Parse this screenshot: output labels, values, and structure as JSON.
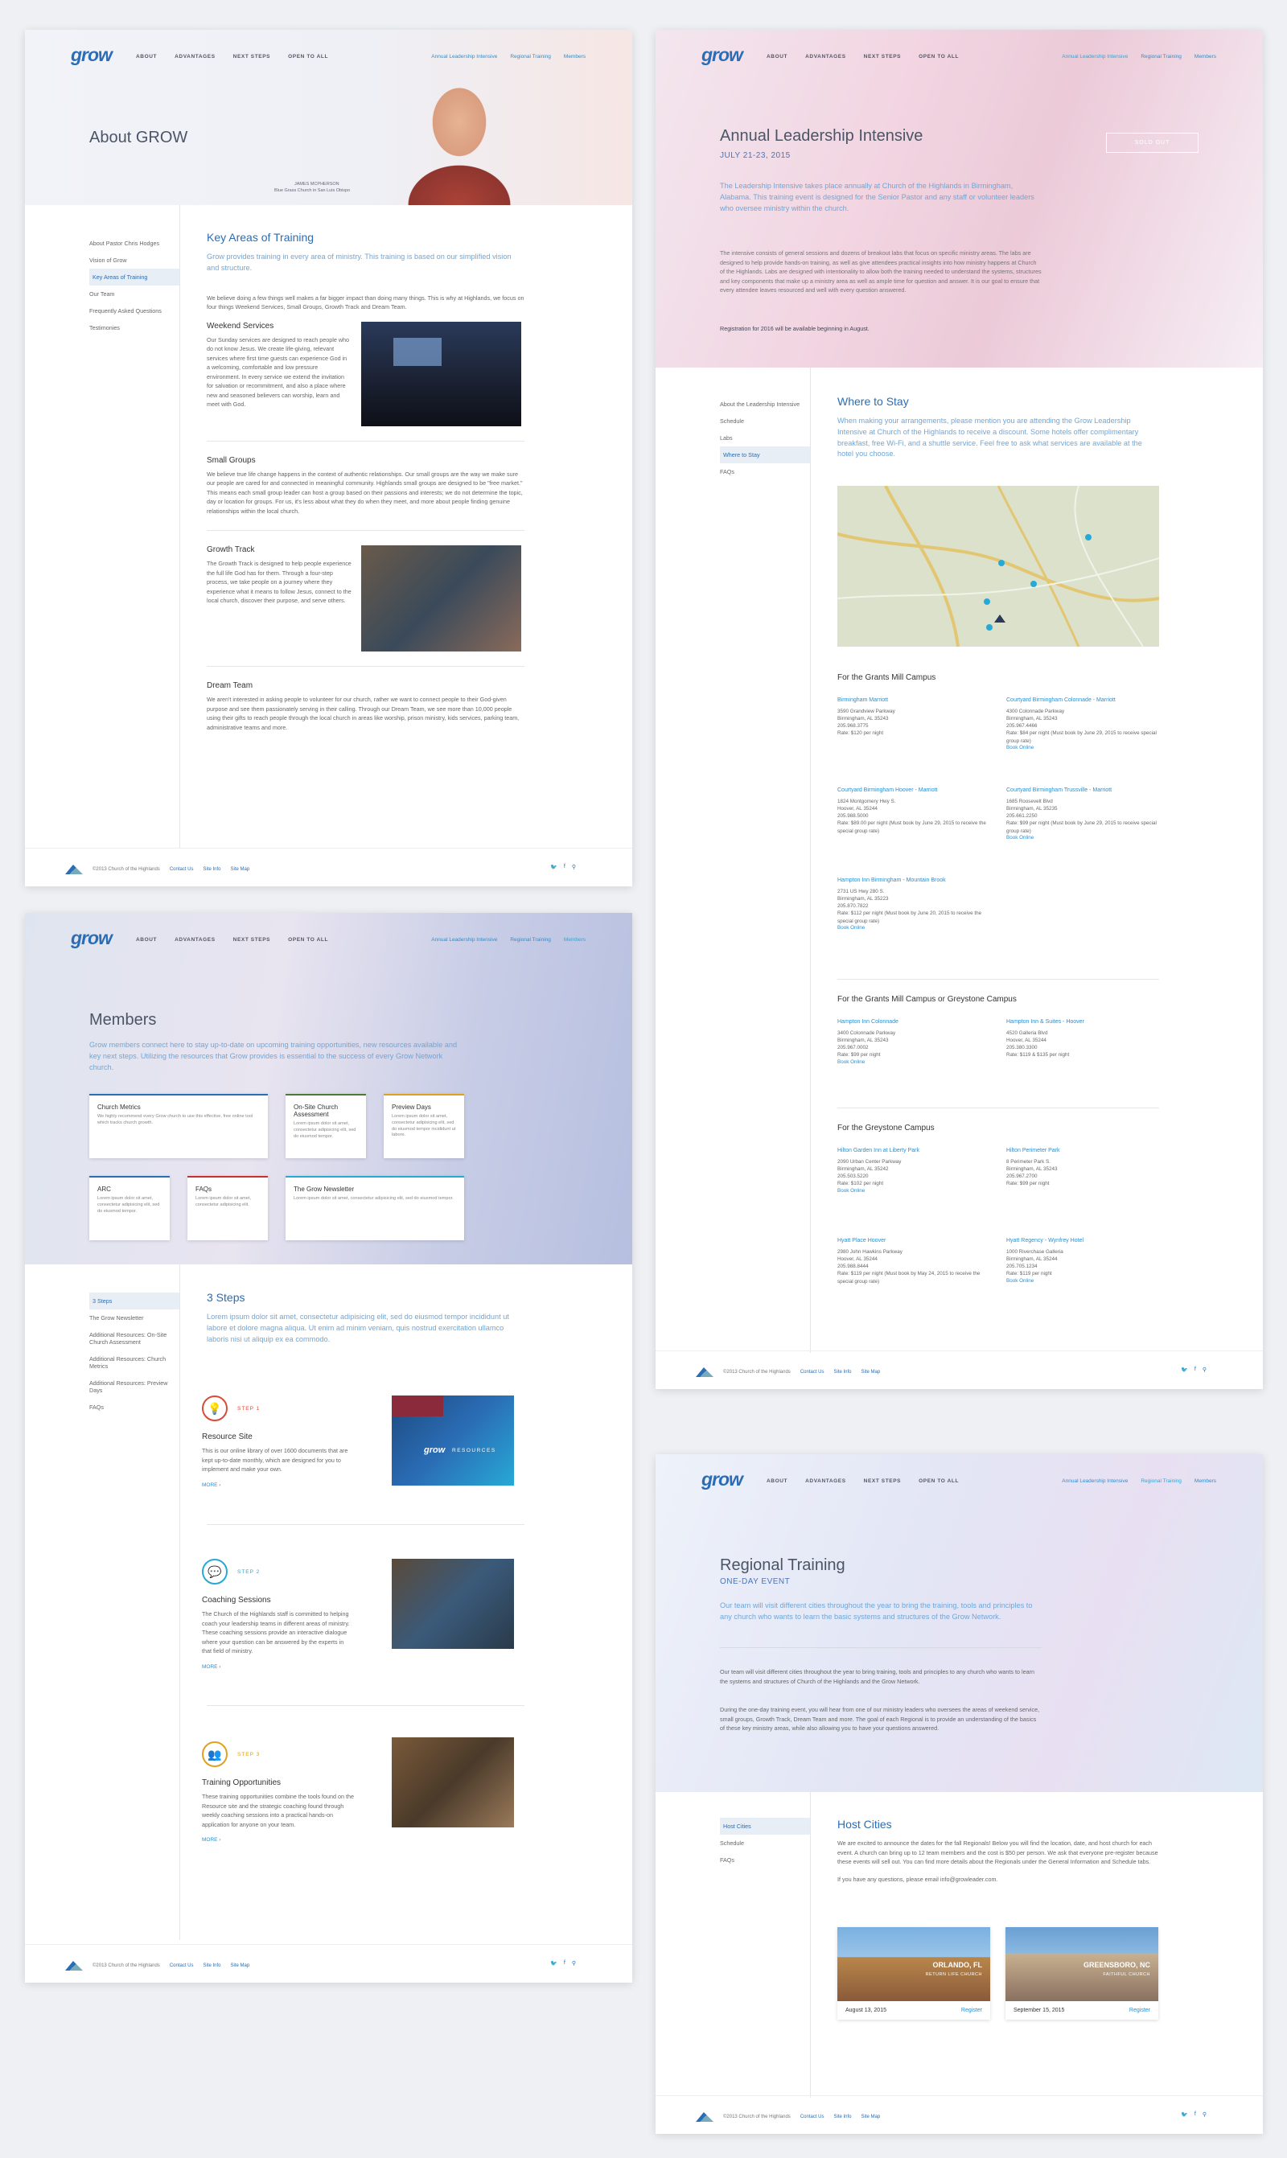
{
  "nav": {
    "logo": "grow",
    "left": [
      "ABOUT",
      "ADVANTAGES",
      "NEXT STEPS",
      "OPEN TO ALL"
    ],
    "right": [
      "Annual Leadership Intensive",
      "Regional Training",
      "Members"
    ]
  },
  "footer": {
    "copyright": "©2013 Church of the Highlands",
    "links": [
      "Contact Us",
      "Site Info",
      "Site Map"
    ],
    "icons": [
      "twitter-icon",
      "facebook-icon",
      "search-icon"
    ]
  },
  "about": {
    "title": "About GROW",
    "caption_name": "JAMES MCPHERSON",
    "caption_role": "Blue Grass Church in San Luis Obispo",
    "sidebar": [
      "About Pastor Chris Hodges",
      "Vision of Grow",
      "Key Areas of Training",
      "Our Team",
      "Frequently Asked Questions",
      "Testimonies"
    ],
    "sidebar_active": 2,
    "heading": "Key Areas of Training",
    "lead": "Grow provides training in every area of ministry. This training is based on our simplified vision and structure.",
    "intro": "We believe doing a few things well makes a far bigger impact than doing many things. This is why at Highlands, we focus on four things Weekend Services, Small Groups, Growth Track and Dream Team.",
    "sections": [
      {
        "title": "Weekend Services",
        "text": "Our Sunday services are designed to reach people who do not know Jesus. We create life-giving, relevant services where first time guests can experience God in a welcoming, comfortable and low pressure environment. In every service we extend the invitation for salvation or recommitment, and also a place where new and seasoned believers can worship, learn and meet with God."
      },
      {
        "title": "Small Groups",
        "text": "We believe true life change happens in the context of authentic relationships. Our small groups are the way we make sure our people are cared for and connected in meaningful community. Highlands small groups are designed to be \"free market.\" This means each small group leader can host a group based on their passions and interests; we do not determine the topic, day or location for groups. For us, it's less about what they do when they meet, and more about people finding genuine relationships within the local church."
      },
      {
        "title": "Growth Track",
        "text": "The Growth Track is designed to help people experience the full life God has for them. Through a four-step process, we take people on a journey where they experience what it means to follow Jesus, connect to the local church, discover their purpose, and serve others."
      },
      {
        "title": "Dream Team",
        "text": "We aren't interested in asking people to volunteer for our church, rather we want to connect people to their God-given purpose and see them passionately serving in their calling. Through our Dream Team, we see more than 10,000 people using their gifts to reach people through the local church in areas like worship, prison ministry, kids services, parking team, administrative teams and more."
      }
    ]
  },
  "members": {
    "title": "Members",
    "lead": "Grow members connect here to stay up-to-date on upcoming training opportunities, new resources available and key next steps. Utilizing the resources that Grow provides is essential to the success of every Grow Network church.",
    "cards": [
      {
        "title": "Church Metrics",
        "text": "We highly recommend every Grow church to use this effective, free online tool which tracks church growth.",
        "color": "#2a6db5"
      },
      {
        "title": "On-Site Church Assessment",
        "text": "Lorem ipsum dolor sit amet, consectetur adipisicing elit, sed do eiusmod tempor.",
        "color": "#4a7a3a"
      },
      {
        "title": "Preview Days",
        "text": "Lorem ipsum dolor sit amet, consectetur adipisicing elit, sed do eiusmod tempor incididunt ut labore.",
        "color": "#e0a020"
      },
      {
        "title": "ARC",
        "text": "Lorem ipsum dolor sit amet, consectetur adipisicing elit, sed do eiusmod tempor.",
        "color": "#2a6db5"
      },
      {
        "title": "FAQs",
        "text": "Lorem ipsum dolor sit amet, consectetur adipisicing elit.",
        "color": "#c83030"
      },
      {
        "title": "The Grow Newsletter",
        "text": "Lorem ipsum dolor sit amet, consectetur adipisicing elit, sed do eiusmod tempor.",
        "color": "#27a9d6"
      }
    ],
    "sidebar": [
      "3 Steps",
      "The Grow Newsletter",
      "Additional Resources: On-Site Church Assessment",
      "Additional Resources: Church Metrics",
      "Additional Resources: Preview Days",
      "FAQs"
    ],
    "sidebar_active": 0,
    "heading": "3 Steps",
    "steps_lead": "Lorem ipsum dolor sit amet, consectetur adipisicing elit, sed do eiusmod tempor incididunt ut labore et dolore magna aliqua. Ut enim ad minim veniam, quis nostrud exercitation ullamco laboris nisi ut aliquip ex ea commodo.",
    "steps": [
      {
        "label": "STEP 1",
        "title": "Resource Site",
        "text": "This is our online library of over 1600 documents that are kept up-to-date monthly, which are designed for you to implement and make your own.",
        "more": "MORE",
        "color": "#d84a3a",
        "icon": "lightbulb-icon"
      },
      {
        "label": "STEP 2",
        "title": "Coaching Sessions",
        "text": "The Church of the Highlands staff is committed to helping coach your leadership teams in different areas of ministry. These coaching sessions provide an interactive dialogue where your question can be answered by the experts in that field of ministry.",
        "more": "MORE",
        "color": "#27a9d6",
        "icon": "chat-icon"
      },
      {
        "label": "STEP 3",
        "title": "Training Opportunities",
        "text": "These training opportunities combine the tools found on the Resource site and the strategic coaching found through weekly coaching sessions into a practical hands-on application for anyone on your team.",
        "more": "MORE",
        "color": "#e0a020",
        "icon": "group-icon"
      }
    ],
    "resource_logo": "grow",
    "resource_word": "RESOURCES"
  },
  "intensive": {
    "title": "Annual Leadership Intensive",
    "date": "JULY 21-23, 2015",
    "badge": "SOLD OUT",
    "lead": "The Leadership Intensive takes place annually at Church of the Highlands in Birmingham, Alabama. This training event is designed for the Senior Pastor and any staff or volunteer leaders who oversee ministry within the church.",
    "body": "The intensive consists of general sessions and dozens of breakout labs that focus on specific ministry areas. The labs are designed to help provide hands-on training, as well as give attendees practical insights into how ministry happens at Church of the Highlands. Labs are designed with intentionality to allow both the training needed to understand the systems, structures and key components that make up a ministry area as well as ample time for question and answer. It is our goal to ensure that every attendee leaves resourced and well with every question answered.",
    "registration": "Registration for 2016 will be available beginning in August.",
    "sidebar": [
      "About the Leadership Intensive",
      "Schedule",
      "Labs",
      "Where to Stay",
      "FAQs"
    ],
    "sidebar_active": 3,
    "heading": "Where to Stay",
    "stay_lead": "When making your arrangements, please mention you are attending the Grow Leadership Intensive at Church of the Highlands to receive a discount. Some hotels offer complimentary breakfast, free Wi-Fi, and a shuttle service. Feel free to ask what services are available at the hotel you choose.",
    "campuses": [
      {
        "name": "For the Grants Mill Campus",
        "hotels": [
          {
            "name": "Birmingham Marriott",
            "lines": [
              "3590 Grandview Parkway",
              "Birmingham, AL 35243",
              "205.968.3775"
            ],
            "rate": "Rate: $120 per night",
            "book": ""
          },
          {
            "name": "Courtyard Birmingham Colonnade - Marriott",
            "lines": [
              "4300 Colonnade Parkway",
              "Birmingham, AL 35243",
              "205.967.4466"
            ],
            "rate": "Rate: $84 per night (Must book by June 29, 2015 to receive special group rate)",
            "book": "Book Online"
          },
          {
            "name": "Courtyard Birmingham Hoover - Marriott",
            "lines": [
              "1824 Montgomery Hwy S.",
              "Hoover, AL 35244",
              "205.988.5000"
            ],
            "rate": "Rate: $89.00 per night (Must book by June 29, 2015 to receive the special group rate)",
            "book": ""
          },
          {
            "name": "Courtyard Birmingham Trussville - Marriott",
            "lines": [
              "1685 Roosevelt Blvd",
              "Birmingham, AL 35235",
              "205.661.2250"
            ],
            "rate": "Rate: $99 per night (Must book by June 29, 2015 to receive special group rate)",
            "book": "Book Online"
          },
          {
            "name": "Hampton Inn Birmingham - Mountain Brook",
            "lines": [
              "2731 US Hwy 280 S.",
              "Birmingham, AL 35223",
              "205.870.7822"
            ],
            "rate": "Rate: $112 per night (Must book by June 20, 2015 to receive the special group rate)",
            "book": "Book Online"
          }
        ]
      },
      {
        "name": "For the Grants Mill Campus or Greystone Campus",
        "hotels": [
          {
            "name": "Hampton Inn Colonnade",
            "lines": [
              "3400 Colonnade Parkway",
              "Birmingham, AL 35243",
              "205.967.0002"
            ],
            "rate": "Rate: $99 per night",
            "book": "Book Online"
          },
          {
            "name": "Hampton Inn & Suites - Hoover",
            "lines": [
              "4520 Galleria Blvd",
              "Hoover, AL 35244",
              "205.380.3300"
            ],
            "rate": "Rate: $119 & $135 per night",
            "book": ""
          }
        ]
      },
      {
        "name": "For the Greystone Campus",
        "hotels": [
          {
            "name": "Hilton Garden Inn at Liberty Park",
            "lines": [
              "2090 Urban Center Parkway",
              "Birmingham, AL 35242",
              "205.503.5220"
            ],
            "rate": "Rate: $102 per night",
            "book": "Book Online"
          },
          {
            "name": "Hilton Perimeter Park",
            "lines": [
              "8 Perimeter Park S.",
              "Birmingham, AL 35243",
              "205.967.2700"
            ],
            "rate": "Rate: $99 per night",
            "book": ""
          },
          {
            "name": "Hyatt Place Hoover",
            "lines": [
              "2980 John Hawkins Parkway",
              "Hoover, AL 35244",
              "205.988.8444"
            ],
            "rate": "Rate: $119 per night (Must book by May 24, 2015 to receive the special group rate)",
            "book": ""
          },
          {
            "name": "Hyatt Regency - Wynfrey Hotel",
            "lines": [
              "1000 Riverchase Galleria",
              "Birmingham, AL 35244",
              "205.705.1234"
            ],
            "rate": "Rate: $119 per night",
            "book": "Book Online"
          }
        ]
      }
    ]
  },
  "regional": {
    "title": "Regional Training",
    "sub": "ONE-DAY EVENT",
    "lead": "Our team will visit different cities throughout the year to bring the training, tools and principles to any church who wants to learn the basic systems and structures of the Grow Network.",
    "body1": "Our team will visit different cities throughout the year to bring training, tools and principles to any church who wants to learn the systems and structures of Church of the Highlands and the Grow Network.",
    "body2": "During the one-day training event, you will hear from one of our ministry leaders who oversees the areas of weekend service, small groups, Growth Track, Dream Team and more. The goal of each Regional is to provide an understanding of the basics of these key ministry areas, while also allowing you to have your questions answered.",
    "sidebar": [
      "Host Cities",
      "Schedule",
      "FAQs"
    ],
    "sidebar_active": 0,
    "heading": "Host Cities",
    "hc_body": "We are excited to announce the dates for the fall Regionals! Below you will find the location, date, and host church for each event. A church can bring up to 12 team members and the cost is $50 per person. We ask that everyone pre-register because these events will sell out. You can find more details about the Regionals under the General Information and Schedule tabs.",
    "hc_contact": "If you have any questions, please email info@growleader.com.",
    "events": [
      {
        "city": "ORLANDO, FL",
        "church": "RETURN LIFE CHURCH",
        "date": "August 13, 2015",
        "register": "Register"
      },
      {
        "city": "GREENSBORO, NC",
        "church": "FAITHFUL CHURCH",
        "date": "September 15, 2015",
        "register": "Register"
      }
    ]
  }
}
